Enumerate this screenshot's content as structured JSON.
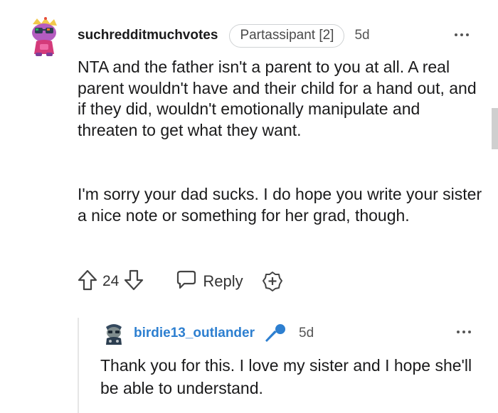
{
  "comment": {
    "username": "suchredditmuchvotes",
    "flair": "Partassipant [2]",
    "time": "5d",
    "paragraphs": [
      "NTA and the father isn't a parent to you at all. A real parent wouldn't have and their child for a hand out, and if they did, wouldn't emotionally manipulate and threaten to get what they want.",
      "I'm sorry your dad sucks. I do hope you write your sister a nice note or something for her grad, though."
    ],
    "vote_count": "24",
    "reply_label": "Reply"
  },
  "reply": {
    "username": "birdie13_outlander",
    "time": "5d",
    "text": "Thank you for this. I love my sister and I hope she'll be able to understand."
  },
  "colors": {
    "accent_username": "#2d7fd0",
    "avatar_purple": "#b45cc0",
    "text": "#1a1a1b"
  },
  "icons": [
    "avatar-icon",
    "more-options-icon",
    "upvote-icon",
    "downvote-icon",
    "reply-bubble-icon",
    "add-award-icon",
    "microphone-icon"
  ]
}
